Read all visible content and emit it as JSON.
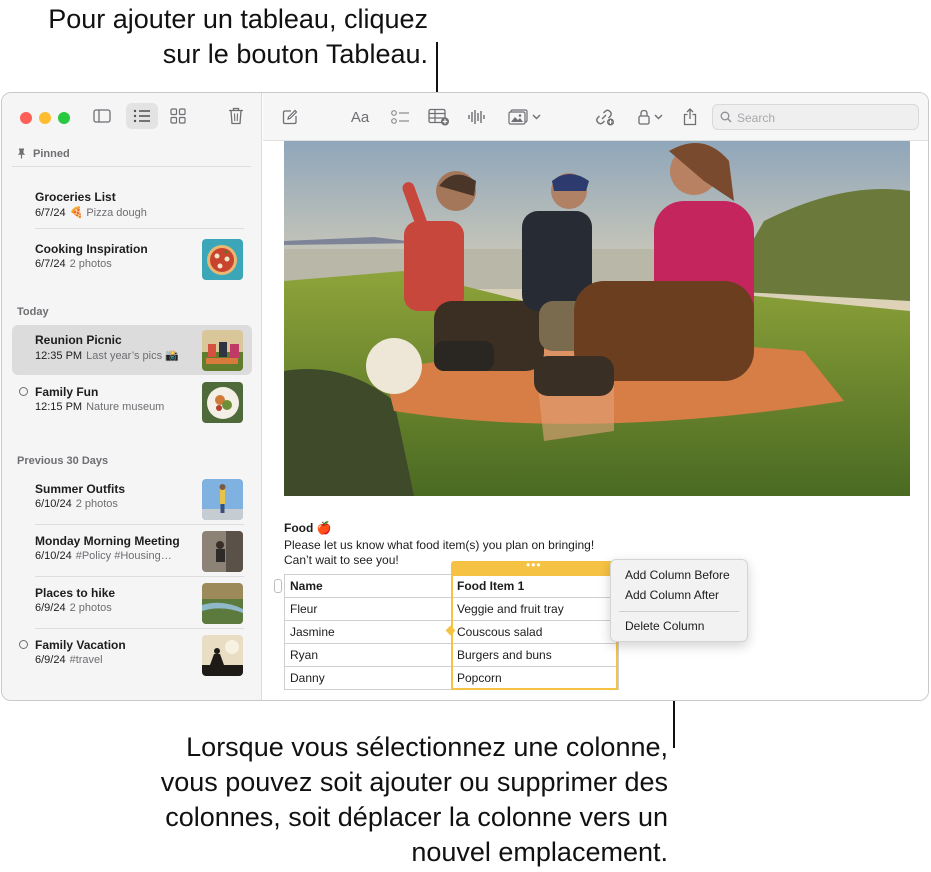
{
  "callouts": {
    "top_line1": "Pour ajouter un tableau, cliquez",
    "top_line2": "sur le bouton Tableau.",
    "bottom_line1": "Lorsque vous sélectionnez une colonne,",
    "bottom_line2": "vous pouvez soit ajouter ou supprimer des",
    "bottom_line3": "colonnes, soit déplacer la colonne vers un",
    "bottom_line4": "nouvel emplacement."
  },
  "sidebar": {
    "pinned_label": "Pinned",
    "today_label": "Today",
    "previous_label": "Previous 30 Days",
    "notes": [
      {
        "title": "Groceries List",
        "date": "6/7/24",
        "sub": "🍕 Pizza dough"
      },
      {
        "title": "Cooking Inspiration",
        "date": "6/7/24",
        "sub": "2 photos"
      },
      {
        "title": "Reunion Picnic",
        "date": "12:35 PM",
        "sub": "Last year’s pics 📸"
      },
      {
        "title": "Family Fun",
        "date": "12:15 PM",
        "sub": "Nature museum"
      },
      {
        "title": "Summer Outfits",
        "date": "6/10/24",
        "sub": "2 photos"
      },
      {
        "title": "Monday Morning Meeting",
        "date": "6/10/24",
        "sub": "#Policy #Housing…"
      },
      {
        "title": "Places to hike",
        "date": "6/9/24",
        "sub": "2 photos"
      },
      {
        "title": "Family Vacation",
        "date": "6/9/24",
        "sub": "#travel"
      }
    ]
  },
  "toolbar": {
    "format_label": "Aa",
    "search_placeholder": "Search"
  },
  "note": {
    "heading": "Food 🍎",
    "line1": "Please let us know what food item(s) you plan on bringing!",
    "line2": "Can’t wait to see you!",
    "table": {
      "headers": [
        "Name",
        "Food Item 1"
      ],
      "rows": [
        [
          "Fleur",
          "Veggie and fruit tray"
        ],
        [
          "Jasmine",
          "Couscous salad"
        ],
        [
          "Ryan",
          "Burgers and buns"
        ],
        [
          "Danny",
          "Popcorn"
        ]
      ]
    }
  },
  "context_menu": {
    "add_before": "Add Column Before",
    "add_after": "Add Column After",
    "delete": "Delete Column"
  },
  "colors": {
    "accent_column": "#f5c243",
    "close": "#fe5f57",
    "minimize": "#febc2e",
    "zoom": "#28c840"
  }
}
